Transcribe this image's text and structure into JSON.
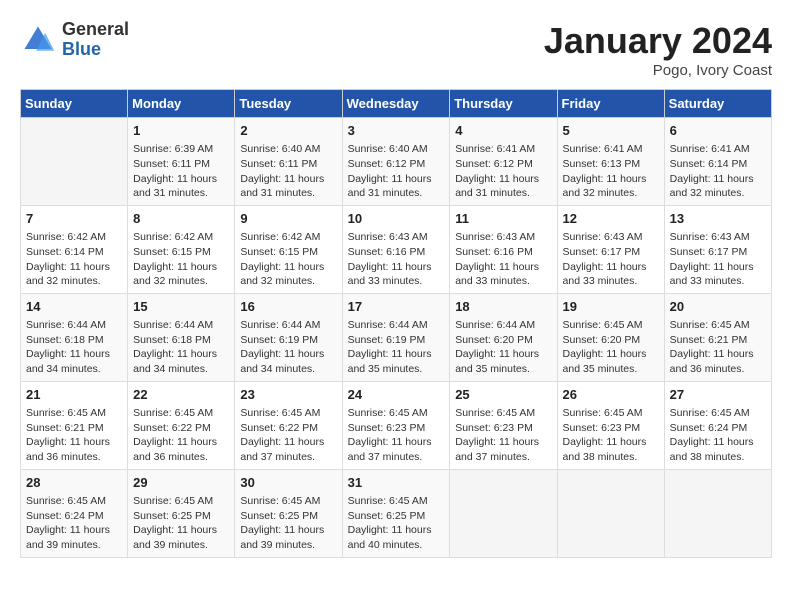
{
  "header": {
    "logo_general": "General",
    "logo_blue": "Blue",
    "month": "January 2024",
    "location": "Pogo, Ivory Coast"
  },
  "days_of_week": [
    "Sunday",
    "Monday",
    "Tuesday",
    "Wednesday",
    "Thursday",
    "Friday",
    "Saturday"
  ],
  "weeks": [
    [
      {
        "day": "",
        "sunrise": "",
        "sunset": "",
        "daylight": ""
      },
      {
        "day": "1",
        "sunrise": "Sunrise: 6:39 AM",
        "sunset": "Sunset: 6:11 PM",
        "daylight": "Daylight: 11 hours and 31 minutes."
      },
      {
        "day": "2",
        "sunrise": "Sunrise: 6:40 AM",
        "sunset": "Sunset: 6:11 PM",
        "daylight": "Daylight: 11 hours and 31 minutes."
      },
      {
        "day": "3",
        "sunrise": "Sunrise: 6:40 AM",
        "sunset": "Sunset: 6:12 PM",
        "daylight": "Daylight: 11 hours and 31 minutes."
      },
      {
        "day": "4",
        "sunrise": "Sunrise: 6:41 AM",
        "sunset": "Sunset: 6:12 PM",
        "daylight": "Daylight: 11 hours and 31 minutes."
      },
      {
        "day": "5",
        "sunrise": "Sunrise: 6:41 AM",
        "sunset": "Sunset: 6:13 PM",
        "daylight": "Daylight: 11 hours and 32 minutes."
      },
      {
        "day": "6",
        "sunrise": "Sunrise: 6:41 AM",
        "sunset": "Sunset: 6:14 PM",
        "daylight": "Daylight: 11 hours and 32 minutes."
      }
    ],
    [
      {
        "day": "7",
        "sunrise": "Sunrise: 6:42 AM",
        "sunset": "Sunset: 6:14 PM",
        "daylight": "Daylight: 11 hours and 32 minutes."
      },
      {
        "day": "8",
        "sunrise": "Sunrise: 6:42 AM",
        "sunset": "Sunset: 6:15 PM",
        "daylight": "Daylight: 11 hours and 32 minutes."
      },
      {
        "day": "9",
        "sunrise": "Sunrise: 6:42 AM",
        "sunset": "Sunset: 6:15 PM",
        "daylight": "Daylight: 11 hours and 32 minutes."
      },
      {
        "day": "10",
        "sunrise": "Sunrise: 6:43 AM",
        "sunset": "Sunset: 6:16 PM",
        "daylight": "Daylight: 11 hours and 33 minutes."
      },
      {
        "day": "11",
        "sunrise": "Sunrise: 6:43 AM",
        "sunset": "Sunset: 6:16 PM",
        "daylight": "Daylight: 11 hours and 33 minutes."
      },
      {
        "day": "12",
        "sunrise": "Sunrise: 6:43 AM",
        "sunset": "Sunset: 6:17 PM",
        "daylight": "Daylight: 11 hours and 33 minutes."
      },
      {
        "day": "13",
        "sunrise": "Sunrise: 6:43 AM",
        "sunset": "Sunset: 6:17 PM",
        "daylight": "Daylight: 11 hours and 33 minutes."
      }
    ],
    [
      {
        "day": "14",
        "sunrise": "Sunrise: 6:44 AM",
        "sunset": "Sunset: 6:18 PM",
        "daylight": "Daylight: 11 hours and 34 minutes."
      },
      {
        "day": "15",
        "sunrise": "Sunrise: 6:44 AM",
        "sunset": "Sunset: 6:18 PM",
        "daylight": "Daylight: 11 hours and 34 minutes."
      },
      {
        "day": "16",
        "sunrise": "Sunrise: 6:44 AM",
        "sunset": "Sunset: 6:19 PM",
        "daylight": "Daylight: 11 hours and 34 minutes."
      },
      {
        "day": "17",
        "sunrise": "Sunrise: 6:44 AM",
        "sunset": "Sunset: 6:19 PM",
        "daylight": "Daylight: 11 hours and 35 minutes."
      },
      {
        "day": "18",
        "sunrise": "Sunrise: 6:44 AM",
        "sunset": "Sunset: 6:20 PM",
        "daylight": "Daylight: 11 hours and 35 minutes."
      },
      {
        "day": "19",
        "sunrise": "Sunrise: 6:45 AM",
        "sunset": "Sunset: 6:20 PM",
        "daylight": "Daylight: 11 hours and 35 minutes."
      },
      {
        "day": "20",
        "sunrise": "Sunrise: 6:45 AM",
        "sunset": "Sunset: 6:21 PM",
        "daylight": "Daylight: 11 hours and 36 minutes."
      }
    ],
    [
      {
        "day": "21",
        "sunrise": "Sunrise: 6:45 AM",
        "sunset": "Sunset: 6:21 PM",
        "daylight": "Daylight: 11 hours and 36 minutes."
      },
      {
        "day": "22",
        "sunrise": "Sunrise: 6:45 AM",
        "sunset": "Sunset: 6:22 PM",
        "daylight": "Daylight: 11 hours and 36 minutes."
      },
      {
        "day": "23",
        "sunrise": "Sunrise: 6:45 AM",
        "sunset": "Sunset: 6:22 PM",
        "daylight": "Daylight: 11 hours and 37 minutes."
      },
      {
        "day": "24",
        "sunrise": "Sunrise: 6:45 AM",
        "sunset": "Sunset: 6:23 PM",
        "daylight": "Daylight: 11 hours and 37 minutes."
      },
      {
        "day": "25",
        "sunrise": "Sunrise: 6:45 AM",
        "sunset": "Sunset: 6:23 PM",
        "daylight": "Daylight: 11 hours and 37 minutes."
      },
      {
        "day": "26",
        "sunrise": "Sunrise: 6:45 AM",
        "sunset": "Sunset: 6:23 PM",
        "daylight": "Daylight: 11 hours and 38 minutes."
      },
      {
        "day": "27",
        "sunrise": "Sunrise: 6:45 AM",
        "sunset": "Sunset: 6:24 PM",
        "daylight": "Daylight: 11 hours and 38 minutes."
      }
    ],
    [
      {
        "day": "28",
        "sunrise": "Sunrise: 6:45 AM",
        "sunset": "Sunset: 6:24 PM",
        "daylight": "Daylight: 11 hours and 39 minutes."
      },
      {
        "day": "29",
        "sunrise": "Sunrise: 6:45 AM",
        "sunset": "Sunset: 6:25 PM",
        "daylight": "Daylight: 11 hours and 39 minutes."
      },
      {
        "day": "30",
        "sunrise": "Sunrise: 6:45 AM",
        "sunset": "Sunset: 6:25 PM",
        "daylight": "Daylight: 11 hours and 39 minutes."
      },
      {
        "day": "31",
        "sunrise": "Sunrise: 6:45 AM",
        "sunset": "Sunset: 6:25 PM",
        "daylight": "Daylight: 11 hours and 40 minutes."
      },
      {
        "day": "",
        "sunrise": "",
        "sunset": "",
        "daylight": ""
      },
      {
        "day": "",
        "sunrise": "",
        "sunset": "",
        "daylight": ""
      },
      {
        "day": "",
        "sunrise": "",
        "sunset": "",
        "daylight": ""
      }
    ]
  ]
}
